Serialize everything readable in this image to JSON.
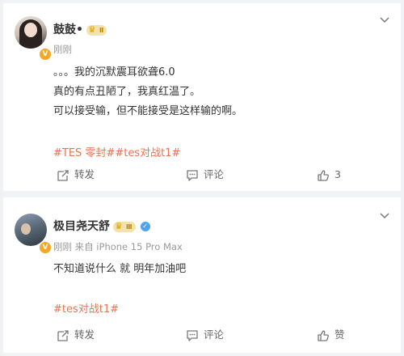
{
  "posts": [
    {
      "username": "鼓鼓•",
      "level": "Ⅱ",
      "meta": "刚刚",
      "lines": [
        "。。。我的沉默震耳欲聋6.0",
        "真的有点丑陋了，我真红温了。",
        "可以接受输，但不能接受是这样输的啊。"
      ],
      "tags": "#TES 零封##tes对战t1#",
      "repost_label": "转发",
      "comment_label": "评论",
      "like_label": "3",
      "icons": [
        "avatar",
        "v-badge",
        "more-chevron-icon",
        "repost-icon",
        "comment-icon",
        "like-icon"
      ]
    },
    {
      "username": "极目尧天舒",
      "level": "Ⅲ",
      "meta": "刚刚  来自 iPhone 15 Pro Max",
      "lines": [
        "不知道说什么 就 明年加油吧"
      ],
      "tags": "#tes对战t1#",
      "repost_label": "转发",
      "comment_label": "评论",
      "like_label": "赞",
      "icons": [
        "avatar",
        "v-badge",
        "blue-verified-icon",
        "more-chevron-icon",
        "repost-icon",
        "comment-icon",
        "like-icon"
      ]
    }
  ],
  "colors": {
    "tag": "#eb7350",
    "meta": "#999999",
    "background": "#f1f2f5"
  }
}
